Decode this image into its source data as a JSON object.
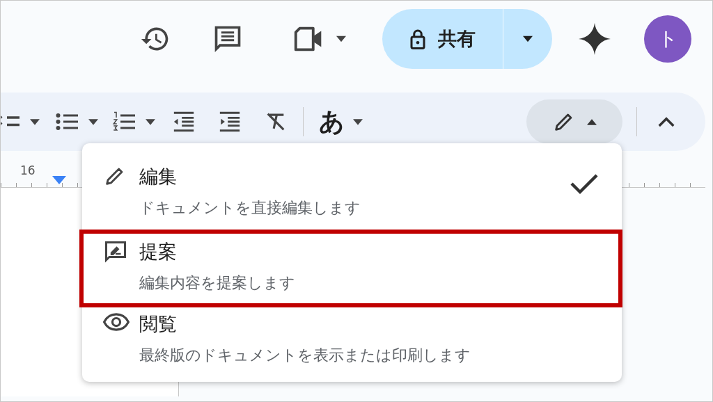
{
  "top_bar": {
    "share_button": {
      "label": "共有"
    },
    "avatar": {
      "initial": "ト"
    }
  },
  "format_toolbar": {
    "input_tools_button": {
      "label": "あ"
    }
  },
  "ruler": {
    "label": "16"
  },
  "mode_menu": {
    "items": [
      {
        "kind": "edit",
        "title": "編集",
        "description": "ドキュメントを直接編集します",
        "checked": true,
        "highlighted": false
      },
      {
        "kind": "suggest",
        "title": "提案",
        "description": "編集内容を提案します",
        "checked": false,
        "highlighted": true
      },
      {
        "kind": "view",
        "title": "閲覧",
        "description": "最終版のドキュメントを表示または印刷します",
        "checked": false,
        "highlighted": false
      }
    ]
  }
}
